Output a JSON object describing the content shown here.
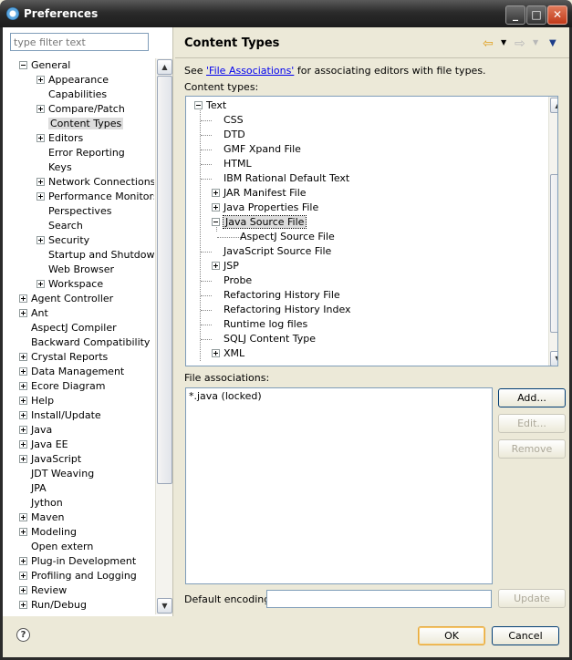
{
  "window": {
    "title": "Preferences"
  },
  "filter": {
    "placeholder": "type filter text"
  },
  "pref_tree": [
    {
      "label": "General",
      "level": 0,
      "exp": "minus"
    },
    {
      "label": "Appearance",
      "level": 1,
      "exp": "plus"
    },
    {
      "label": "Capabilities",
      "level": 1,
      "exp": ""
    },
    {
      "label": "Compare/Patch",
      "level": 1,
      "exp": "plus"
    },
    {
      "label": "Content Types",
      "level": 1,
      "exp": "",
      "selected": true
    },
    {
      "label": "Editors",
      "level": 1,
      "exp": "plus"
    },
    {
      "label": "Error Reporting",
      "level": 1,
      "exp": ""
    },
    {
      "label": "Keys",
      "level": 1,
      "exp": ""
    },
    {
      "label": "Network Connections",
      "level": 1,
      "exp": "plus"
    },
    {
      "label": "Performance Monitors",
      "level": 1,
      "exp": "plus"
    },
    {
      "label": "Perspectives",
      "level": 1,
      "exp": ""
    },
    {
      "label": "Search",
      "level": 1,
      "exp": ""
    },
    {
      "label": "Security",
      "level": 1,
      "exp": "plus"
    },
    {
      "label": "Startup and Shutdown",
      "level": 1,
      "exp": ""
    },
    {
      "label": "Web Browser",
      "level": 1,
      "exp": ""
    },
    {
      "label": "Workspace",
      "level": 1,
      "exp": "plus"
    },
    {
      "label": "Agent Controller",
      "level": 0,
      "exp": "plus"
    },
    {
      "label": "Ant",
      "level": 0,
      "exp": "plus"
    },
    {
      "label": "AspectJ Compiler",
      "level": 0,
      "exp": ""
    },
    {
      "label": "Backward Compatibility",
      "level": 0,
      "exp": ""
    },
    {
      "label": "Crystal Reports",
      "level": 0,
      "exp": "plus"
    },
    {
      "label": "Data Management",
      "level": 0,
      "exp": "plus"
    },
    {
      "label": "Ecore Diagram",
      "level": 0,
      "exp": "plus"
    },
    {
      "label": "Help",
      "level": 0,
      "exp": "plus"
    },
    {
      "label": "Install/Update",
      "level": 0,
      "exp": "plus"
    },
    {
      "label": "Java",
      "level": 0,
      "exp": "plus"
    },
    {
      "label": "Java EE",
      "level": 0,
      "exp": "plus"
    },
    {
      "label": "JavaScript",
      "level": 0,
      "exp": "plus"
    },
    {
      "label": "JDT Weaving",
      "level": 0,
      "exp": ""
    },
    {
      "label": "JPA",
      "level": 0,
      "exp": ""
    },
    {
      "label": "Jython",
      "level": 0,
      "exp": ""
    },
    {
      "label": "Maven",
      "level": 0,
      "exp": "plus"
    },
    {
      "label": "Modeling",
      "level": 0,
      "exp": "plus"
    },
    {
      "label": "Open extern",
      "level": 0,
      "exp": ""
    },
    {
      "label": "Plug-in Development",
      "level": 0,
      "exp": "plus"
    },
    {
      "label": "Profiling and Logging",
      "level": 0,
      "exp": "plus"
    },
    {
      "label": "Review",
      "level": 0,
      "exp": "plus"
    },
    {
      "label": "Run/Debug",
      "level": 0,
      "exp": "plus"
    }
  ],
  "page": {
    "title": "Content Types",
    "desc_prefix": "See ",
    "desc_link": "'File Associations'",
    "desc_suffix": " for associating editors with file types.",
    "content_types_label": "Content types:",
    "file_assoc_label": "File associations:",
    "default_encoding_label": "Default encoding:"
  },
  "content_tree": [
    {
      "label": "Text",
      "level": 0,
      "exp": "minus"
    },
    {
      "label": "CSS",
      "level": 1,
      "exp": ""
    },
    {
      "label": "DTD",
      "level": 1,
      "exp": ""
    },
    {
      "label": "GMF Xpand File",
      "level": 1,
      "exp": ""
    },
    {
      "label": "HTML",
      "level": 1,
      "exp": ""
    },
    {
      "label": "IBM Rational Default Text",
      "level": 1,
      "exp": ""
    },
    {
      "label": "JAR Manifest File",
      "level": 1,
      "exp": "plus"
    },
    {
      "label": "Java Properties File",
      "level": 1,
      "exp": "plus"
    },
    {
      "label": "Java Source File",
      "level": 1,
      "exp": "minus",
      "selected": true
    },
    {
      "label": "AspectJ Source File",
      "level": 2,
      "exp": ""
    },
    {
      "label": "JavaScript Source File",
      "level": 1,
      "exp": ""
    },
    {
      "label": "JSP",
      "level": 1,
      "exp": "plus"
    },
    {
      "label": "Probe",
      "level": 1,
      "exp": ""
    },
    {
      "label": "Refactoring History File",
      "level": 1,
      "exp": ""
    },
    {
      "label": "Refactoring History Index",
      "level": 1,
      "exp": ""
    },
    {
      "label": "Runtime log files",
      "level": 1,
      "exp": ""
    },
    {
      "label": "SQLJ Content Type",
      "level": 1,
      "exp": ""
    },
    {
      "label": "XML",
      "level": 1,
      "exp": "plus"
    }
  ],
  "file_associations": [
    "*.java (locked)"
  ],
  "buttons": {
    "add": "Add...",
    "edit": "Edit...",
    "remove": "Remove",
    "update": "Update",
    "ok": "OK",
    "cancel": "Cancel"
  },
  "encoding_value": ""
}
